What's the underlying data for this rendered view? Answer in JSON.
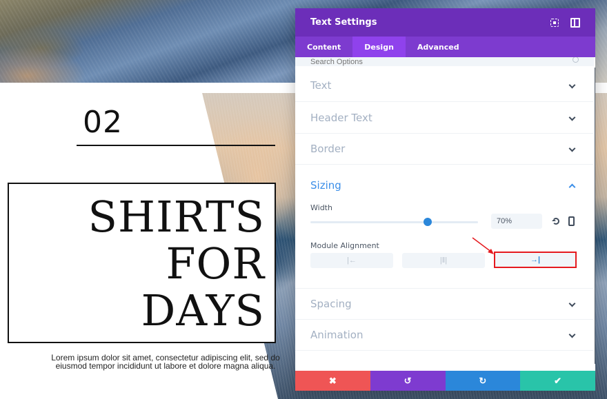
{
  "page": {
    "number": "02",
    "title_lines": [
      "SHIRTS",
      "FOR",
      "DAYS"
    ],
    "body_text_line1": "Lorem ipsum dolor sit amet, consectetur adipiscing elit, sed do",
    "body_text_line2": "eiusmod tempor incididunt ut labore et dolore magna aliqua."
  },
  "modal": {
    "title": "Text Settings",
    "header_icons": [
      "expand-icon",
      "sidebar-toggle-icon"
    ],
    "tabs": [
      {
        "label": "Content",
        "active": false
      },
      {
        "label": "Design",
        "active": true
      },
      {
        "label": "Advanced",
        "active": false
      }
    ],
    "search": {
      "placeholder": "Search Options"
    },
    "sections": [
      {
        "label": "Text",
        "open": false
      },
      {
        "label": "Header Text",
        "open": false
      },
      {
        "label": "Border",
        "open": false
      },
      {
        "label": "Sizing",
        "open": true
      },
      {
        "label": "Spacing",
        "open": false
      },
      {
        "label": "Animation",
        "open": false
      }
    ],
    "sizing": {
      "width_label": "Width",
      "width_value": "70%",
      "width_slider_percent": 70,
      "module_alignment_label": "Module Alignment",
      "alignment_options": [
        {
          "name": "left",
          "glyph": "|←"
        },
        {
          "name": "center",
          "glyph": "|‖|"
        },
        {
          "name": "right",
          "glyph": "→|"
        }
      ],
      "selected_alignment": "right"
    },
    "footer": {
      "discard_icon": "✖",
      "undo_icon": "↺",
      "redo_icon": "↻",
      "save_icon": "✔"
    },
    "colors": {
      "header": "#6c2eb9",
      "tabs": "#7d3bcf",
      "active_tab": "#8f42ec",
      "accent_blue": "#2b87da",
      "discard": "#ef5555",
      "undo": "#7e3bd0",
      "redo": "#2b87da",
      "save": "#29c4a9",
      "highlight": "#e5191e"
    }
  }
}
